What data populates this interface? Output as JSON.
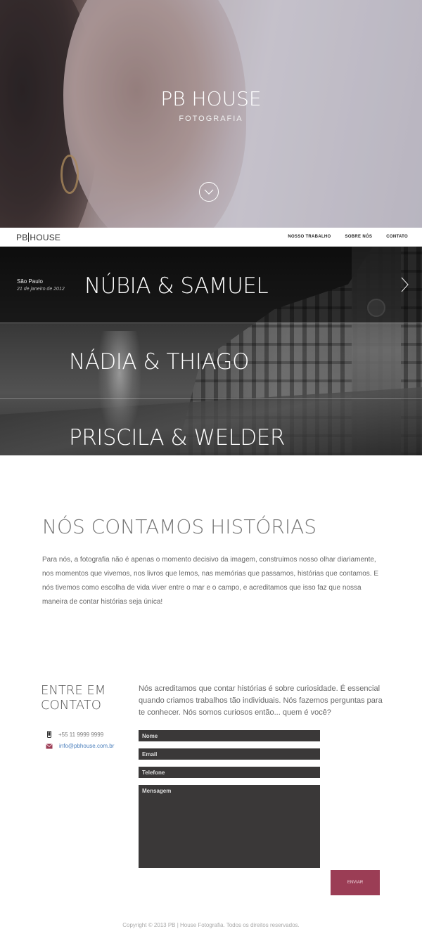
{
  "hero": {
    "title": "PB HOUSE",
    "subtitle": "FOTOGRAFIA",
    "scroll_icon": "chevron-down-icon"
  },
  "nav": {
    "logo_left": "PB",
    "logo_right": "HOUSE",
    "links": [
      "NOSSO TRABALHO",
      "SOBRE NÓS",
      "CONTATO"
    ]
  },
  "gallery": {
    "featured": {
      "city": "São Paulo",
      "date": "21 de janeiro de 2012",
      "title": "NÚBIA & SAMUEL"
    },
    "items": [
      "NÁDIA & THIAGO",
      "PRISCILA & WELDER"
    ],
    "next_icon": "chevron-right-icon"
  },
  "story": {
    "title": "NÓS CONTAMOS HISTÓRIAS",
    "text": "Para nós, a fotografia não é apenas o momento decisivo da imagem, construimos nosso olhar diariamente, nos momentos que vivemos, nos livros que lemos, nas memórias que passamos, histórias que contamos. E nós tivemos como escolha de vida viver entre o mar e o campo, e acreditamos que isso faz que nossa maneira de contar histórias seja única!"
  },
  "contact": {
    "title": "ENTRE EM CONTATO",
    "phone": "+55 11 9999 9999",
    "email": "info@pbhouse.com.br",
    "intro": "Nós acreditamos que contar histórias é sobre curiosidade. É essencial quando criamos trabalhos tão individuais. Nós fazemos perguntas para te conhecer. Nós somos curiosos então... quem é você?",
    "fields": {
      "name": "Nome",
      "email": "Email",
      "phone": "Telefone",
      "message": "Mensagem"
    },
    "submit": "ENVIAR",
    "accent": "#9b3d55"
  },
  "footer": {
    "copyright": "Copyright © 2013 PB | House Fotografia. Todos os direitos reservados."
  }
}
